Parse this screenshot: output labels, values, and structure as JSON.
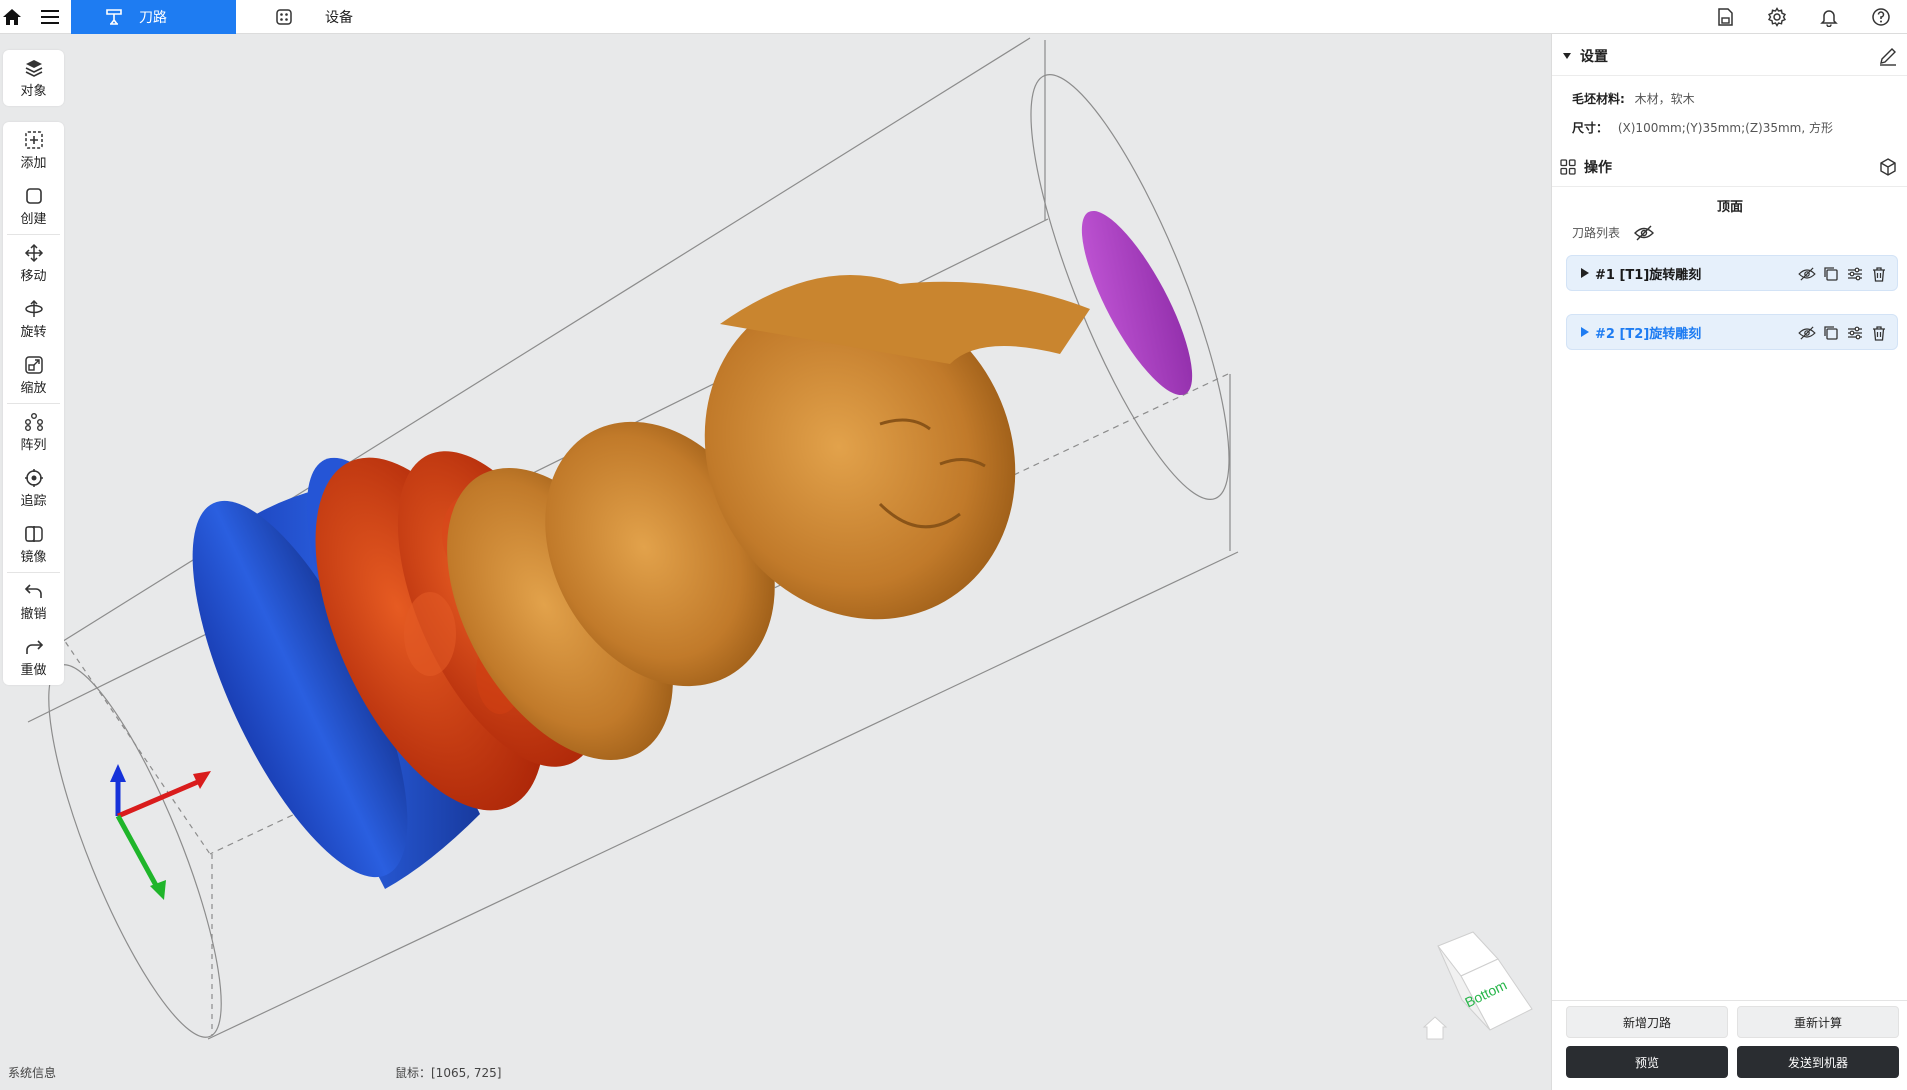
{
  "topbar": {
    "tab_toolpath": "刀路",
    "tab_device": "设备"
  },
  "toolbar": {
    "object": "对象",
    "add": "添加",
    "create": "创建",
    "move": "移动",
    "rotate": "旋转",
    "scale": "缩放",
    "array": "阵列",
    "trace": "追踪",
    "mirror": "镜像",
    "undo": "撤销",
    "redo": "重做"
  },
  "viewport": {
    "view_cube_label": "Bottom",
    "system_info": "系统信息",
    "mouse_coords": "鼠标：[1065, 725]"
  },
  "settings": {
    "title": "设置",
    "material_key": "毛坯材料:",
    "material_value": "木材，软木",
    "size_key": "尺寸：",
    "size_value": "(X)100mm;(Y)35mm;(Z)35mm, 方形"
  },
  "operations": {
    "title": "操作",
    "face": "顶面",
    "toolpath_list": "刀路列表",
    "items": [
      {
        "name": "#1 [T1]旋转雕刻",
        "color": "#1a1a1a"
      },
      {
        "name": "#2 [T2]旋转雕刻",
        "color": "#1e7cf2"
      }
    ]
  },
  "actions": {
    "add_toolpath": "新增刀路",
    "recalculate": "重新计算",
    "preview": "预览",
    "send_to_machine": "发送到机器"
  },
  "colors": {
    "accent": "#1e7cf2",
    "dark_button": "#2a2d31",
    "viewport_bg": "#e8e9ea",
    "model_wood": "#c7842e",
    "model_red": "#c9340e",
    "model_blue": "#1b47c2",
    "model_purple": "#a53fc0"
  }
}
